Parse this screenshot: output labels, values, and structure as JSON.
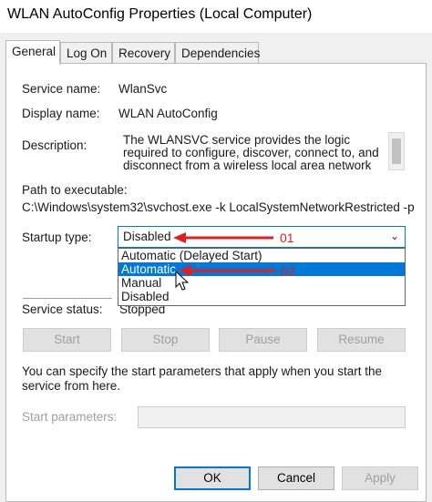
{
  "window": {
    "title": "WLAN AutoConfig Properties (Local Computer)"
  },
  "tabs": [
    {
      "label": "General",
      "active": true
    },
    {
      "label": "Log On",
      "active": false
    },
    {
      "label": "Recovery",
      "active": false
    },
    {
      "label": "Dependencies",
      "active": false
    }
  ],
  "general": {
    "service_name_label": "Service name:",
    "service_name_value": "WlanSvc",
    "display_name_label": "Display name:",
    "display_name_value": "WLAN AutoConfig",
    "description_label": "Description:",
    "description_value": "The WLANSVC service provides the logic required to configure, discover, connect to, and disconnect from a wireless local area network (WLAN) as",
    "path_label": "Path to executable:",
    "path_value": "C:\\Windows\\system32\\svchost.exe -k LocalSystemNetworkRestricted -p",
    "startup_type_label": "Startup type:",
    "startup_type_value": "Disabled",
    "startup_options": [
      "Automatic (Delayed Start)",
      "Automatic",
      "Manual",
      "Disabled"
    ],
    "highlighted_option": "Automatic",
    "service_status_label": "Service status:",
    "service_status_value": "Stopped",
    "buttons": {
      "start": "Start",
      "stop": "Stop",
      "pause": "Pause",
      "resume": "Resume"
    },
    "info_text": "You can specify the start parameters that apply when you start the service from here.",
    "start_params_label": "Start parameters:",
    "start_params_value": ""
  },
  "footer": {
    "ok": "OK",
    "cancel": "Cancel",
    "apply": "Apply"
  },
  "annotations": {
    "first": "01",
    "second": "02"
  },
  "colors": {
    "accent": "#0078d7",
    "annotation": "#e02020"
  }
}
